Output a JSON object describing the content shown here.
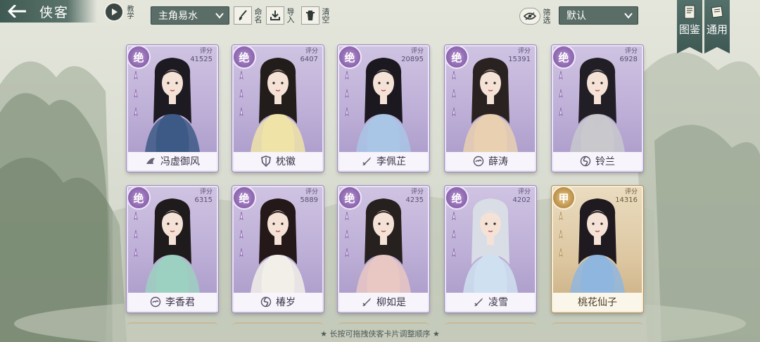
{
  "header": {
    "back_icon": "back-arrow-icon",
    "title": "侠客",
    "tutorial_label": "教学"
  },
  "toolbar": {
    "protagonist_dropdown": "主角易水",
    "rename_label": "命名",
    "import_label": "导入",
    "clear_label": "清空",
    "filter_label": "筛选",
    "sort_dropdown": "默认"
  },
  "banners": {
    "codex_label": "图鉴",
    "general_label": "通用"
  },
  "cards": [
    {
      "grade": "绝",
      "score_label": "评分",
      "score": "41525",
      "name": "冯虚御风",
      "faction_icon": "wing-icon",
      "rarity": "purple"
    },
    {
      "grade": "绝",
      "score_label": "评分",
      "score": "6407",
      "name": "枕徽",
      "faction_icon": "shield-icon",
      "rarity": "purple"
    },
    {
      "grade": "绝",
      "score_label": "评分",
      "score": "20895",
      "name": "李佩芷",
      "faction_icon": "sword-icon",
      "rarity": "purple"
    },
    {
      "grade": "绝",
      "score_label": "评分",
      "score": "15391",
      "name": "薛涛",
      "faction_icon": "cloud-icon",
      "rarity": "purple"
    },
    {
      "grade": "绝",
      "score_label": "评分",
      "score": "6928",
      "name": "铃兰",
      "faction_icon": "swirl-icon",
      "rarity": "purple"
    },
    {
      "grade": "绝",
      "score_label": "评分",
      "score": "6315",
      "name": "李香君",
      "faction_icon": "cloud-icon",
      "rarity": "purple"
    },
    {
      "grade": "绝",
      "score_label": "评分",
      "score": "5889",
      "name": "椿岁",
      "faction_icon": "swirl-icon",
      "rarity": "purple"
    },
    {
      "grade": "绝",
      "score_label": "评分",
      "score": "4235",
      "name": "柳如是",
      "faction_icon": "sword-icon",
      "rarity": "purple"
    },
    {
      "grade": "绝",
      "score_label": "评分",
      "score": "4202",
      "name": "凌雪",
      "faction_icon": "sword-icon",
      "rarity": "purple"
    },
    {
      "grade": "甲",
      "score_label": "评分",
      "score": "14316",
      "name": "桃花仙子",
      "faction_icon": "",
      "rarity": "gold"
    }
  ],
  "footer": {
    "tip": "★ 长按可拖拽侠客卡片调整顺序 ★"
  },
  "colors": {
    "accent_dark": "#5a6d67",
    "card_purple": "#bcaed6",
    "card_gold": "#dcc6a0"
  }
}
